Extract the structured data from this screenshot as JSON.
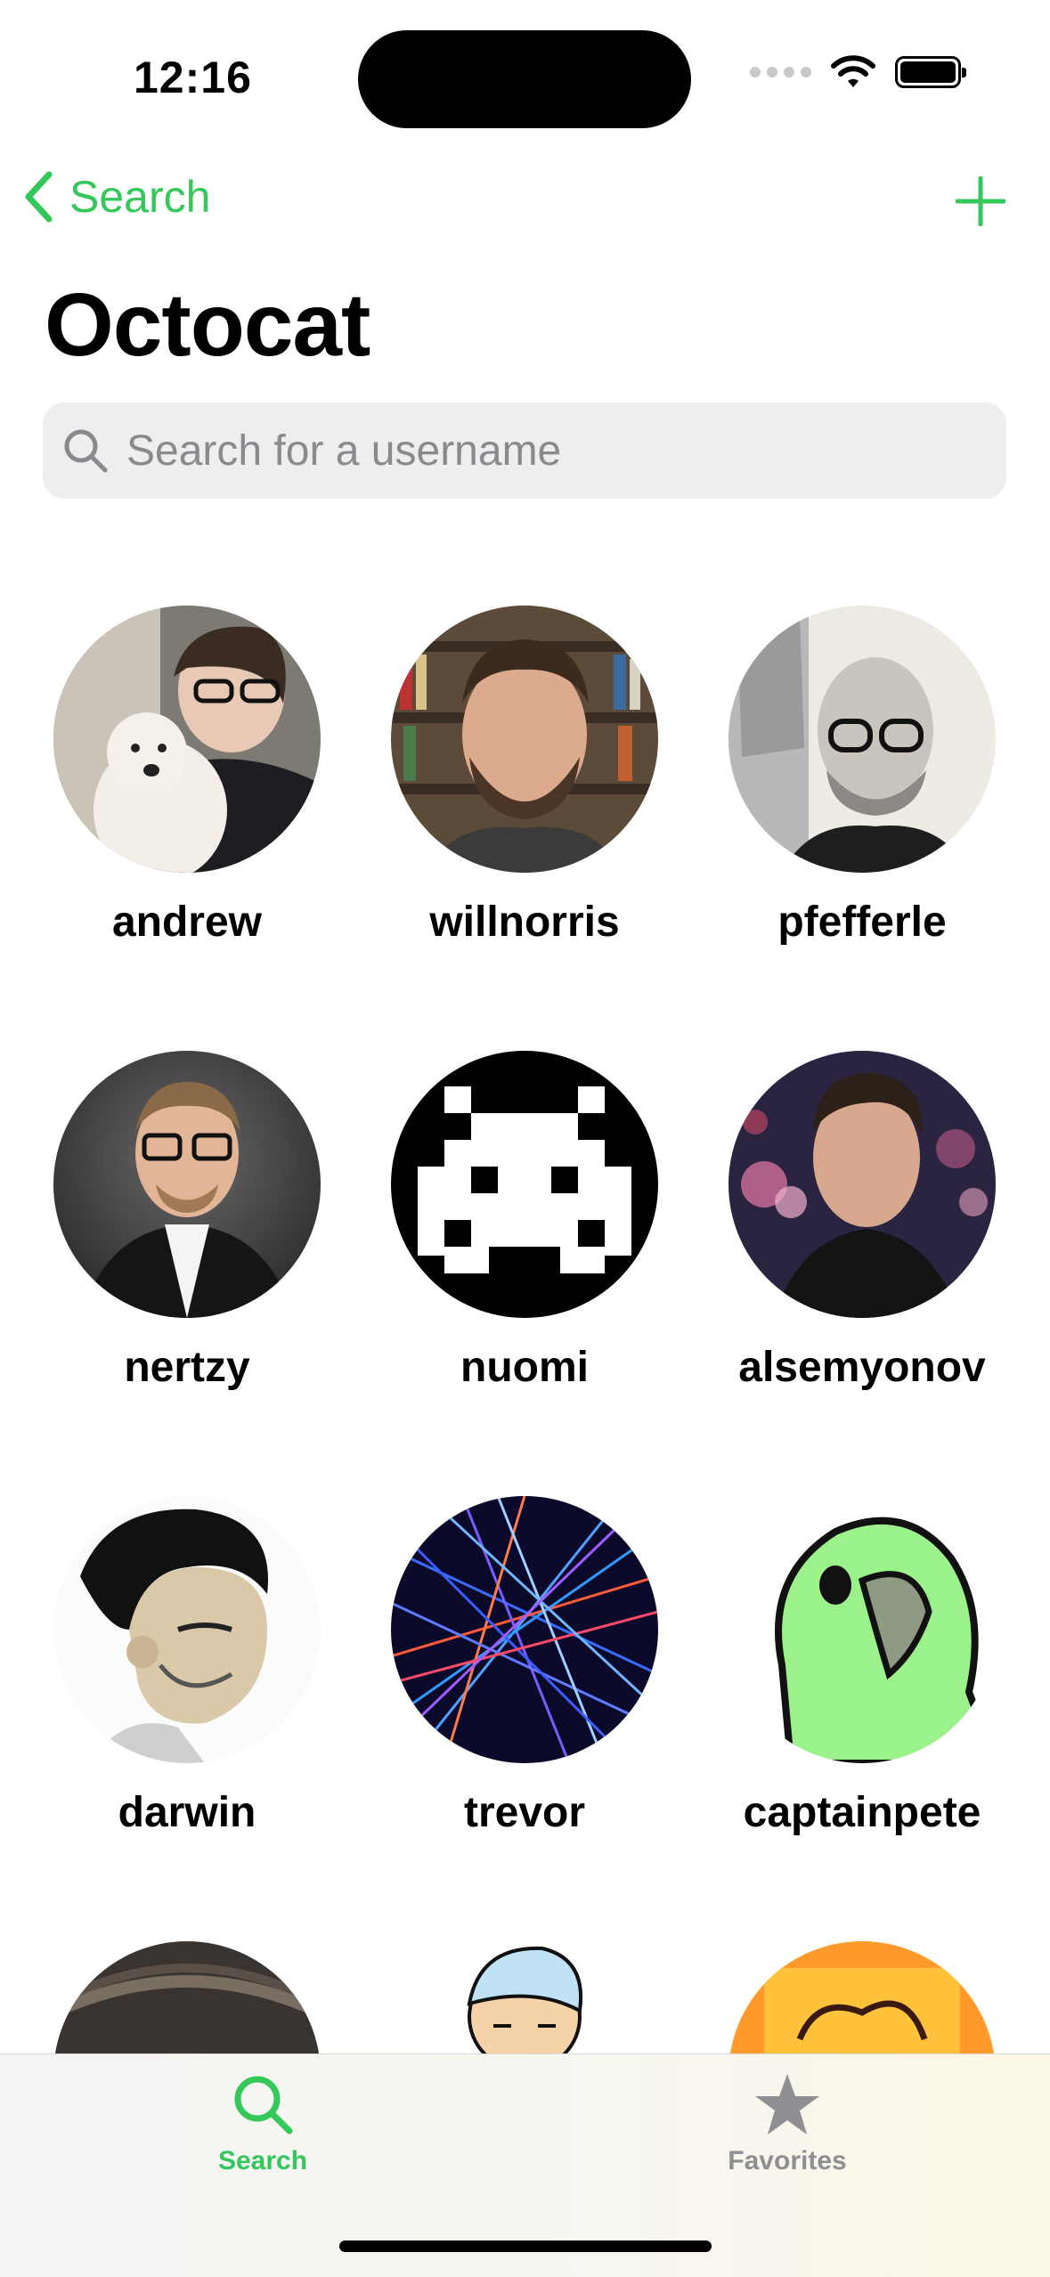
{
  "status_bar": {
    "time": "12:16"
  },
  "nav": {
    "back_label": "Search"
  },
  "page": {
    "title": "Octocat"
  },
  "search": {
    "placeholder": "Search for a username",
    "value": ""
  },
  "users": [
    {
      "username": "andrew"
    },
    {
      "username": "willnorris"
    },
    {
      "username": "pfefferle"
    },
    {
      "username": "nertzy"
    },
    {
      "username": "nuomi"
    },
    {
      "username": "alsemyonov"
    },
    {
      "username": "darwin"
    },
    {
      "username": "trevor"
    },
    {
      "username": "captainpete"
    },
    {
      "username": ""
    },
    {
      "username": ""
    },
    {
      "username": ""
    }
  ],
  "tabbar": {
    "tabs": [
      {
        "label": "Search",
        "icon": "magnifier-icon",
        "selected": true
      },
      {
        "label": "Favorites",
        "icon": "star-icon",
        "selected": false
      }
    ]
  },
  "colors": {
    "accent": "#34c759",
    "inactive_tab": "#8e8e93"
  }
}
